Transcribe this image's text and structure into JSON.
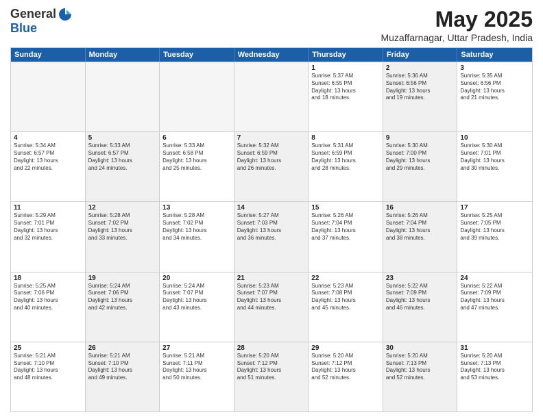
{
  "logo": {
    "general": "General",
    "blue": "Blue"
  },
  "header": {
    "month": "May 2025",
    "location": "Muzaffarnagar, Uttar Pradesh, India"
  },
  "days": [
    "Sunday",
    "Monday",
    "Tuesday",
    "Wednesday",
    "Thursday",
    "Friday",
    "Saturday"
  ],
  "rows": [
    [
      {
        "day": "",
        "text": "",
        "empty": true
      },
      {
        "day": "",
        "text": "",
        "empty": true
      },
      {
        "day": "",
        "text": "",
        "empty": true
      },
      {
        "day": "",
        "text": "",
        "empty": true
      },
      {
        "day": "1",
        "text": "Sunrise: 5:37 AM\nSunset: 6:55 PM\nDaylight: 13 hours\nand 18 minutes.",
        "shaded": false
      },
      {
        "day": "2",
        "text": "Sunrise: 5:36 AM\nSunset: 6:56 PM\nDaylight: 13 hours\nand 19 minutes.",
        "shaded": true
      },
      {
        "day": "3",
        "text": "Sunrise: 5:35 AM\nSunset: 6:56 PM\nDaylight: 13 hours\nand 21 minutes.",
        "shaded": false
      }
    ],
    [
      {
        "day": "4",
        "text": "Sunrise: 5:34 AM\nSunset: 6:57 PM\nDaylight: 13 hours\nand 22 minutes.",
        "shaded": false
      },
      {
        "day": "5",
        "text": "Sunrise: 5:33 AM\nSunset: 6:57 PM\nDaylight: 13 hours\nand 24 minutes.",
        "shaded": true
      },
      {
        "day": "6",
        "text": "Sunrise: 5:33 AM\nSunset: 6:58 PM\nDaylight: 13 hours\nand 25 minutes.",
        "shaded": false
      },
      {
        "day": "7",
        "text": "Sunrise: 5:32 AM\nSunset: 6:59 PM\nDaylight: 13 hours\nand 26 minutes.",
        "shaded": true
      },
      {
        "day": "8",
        "text": "Sunrise: 5:31 AM\nSunset: 6:59 PM\nDaylight: 13 hours\nand 28 minutes.",
        "shaded": false
      },
      {
        "day": "9",
        "text": "Sunrise: 5:30 AM\nSunset: 7:00 PM\nDaylight: 13 hours\nand 29 minutes.",
        "shaded": true
      },
      {
        "day": "10",
        "text": "Sunrise: 5:30 AM\nSunset: 7:01 PM\nDaylight: 13 hours\nand 30 minutes.",
        "shaded": false
      }
    ],
    [
      {
        "day": "11",
        "text": "Sunrise: 5:29 AM\nSunset: 7:01 PM\nDaylight: 13 hours\nand 32 minutes.",
        "shaded": false
      },
      {
        "day": "12",
        "text": "Sunrise: 5:28 AM\nSunset: 7:02 PM\nDaylight: 13 hours\nand 33 minutes.",
        "shaded": true
      },
      {
        "day": "13",
        "text": "Sunrise: 5:28 AM\nSunset: 7:02 PM\nDaylight: 13 hours\nand 34 minutes.",
        "shaded": false
      },
      {
        "day": "14",
        "text": "Sunrise: 5:27 AM\nSunset: 7:03 PM\nDaylight: 13 hours\nand 36 minutes.",
        "shaded": true
      },
      {
        "day": "15",
        "text": "Sunrise: 5:26 AM\nSunset: 7:04 PM\nDaylight: 13 hours\nand 37 minutes.",
        "shaded": false
      },
      {
        "day": "16",
        "text": "Sunrise: 5:26 AM\nSunset: 7:04 PM\nDaylight: 13 hours\nand 38 minutes.",
        "shaded": true
      },
      {
        "day": "17",
        "text": "Sunrise: 5:25 AM\nSunset: 7:05 PM\nDaylight: 13 hours\nand 39 minutes.",
        "shaded": false
      }
    ],
    [
      {
        "day": "18",
        "text": "Sunrise: 5:25 AM\nSunset: 7:06 PM\nDaylight: 13 hours\nand 40 minutes.",
        "shaded": false
      },
      {
        "day": "19",
        "text": "Sunrise: 5:24 AM\nSunset: 7:06 PM\nDaylight: 13 hours\nand 42 minutes.",
        "shaded": true
      },
      {
        "day": "20",
        "text": "Sunrise: 5:24 AM\nSunset: 7:07 PM\nDaylight: 13 hours\nand 43 minutes.",
        "shaded": false
      },
      {
        "day": "21",
        "text": "Sunrise: 5:23 AM\nSunset: 7:07 PM\nDaylight: 13 hours\nand 44 minutes.",
        "shaded": true
      },
      {
        "day": "22",
        "text": "Sunrise: 5:23 AM\nSunset: 7:08 PM\nDaylight: 13 hours\nand 45 minutes.",
        "shaded": false
      },
      {
        "day": "23",
        "text": "Sunrise: 5:22 AM\nSunset: 7:09 PM\nDaylight: 13 hours\nand 46 minutes.",
        "shaded": true
      },
      {
        "day": "24",
        "text": "Sunrise: 5:22 AM\nSunset: 7:09 PM\nDaylight: 13 hours\nand 47 minutes.",
        "shaded": false
      }
    ],
    [
      {
        "day": "25",
        "text": "Sunrise: 5:21 AM\nSunset: 7:10 PM\nDaylight: 13 hours\nand 48 minutes.",
        "shaded": false
      },
      {
        "day": "26",
        "text": "Sunrise: 5:21 AM\nSunset: 7:10 PM\nDaylight: 13 hours\nand 49 minutes.",
        "shaded": true
      },
      {
        "day": "27",
        "text": "Sunrise: 5:21 AM\nSunset: 7:11 PM\nDaylight: 13 hours\nand 50 minutes.",
        "shaded": false
      },
      {
        "day": "28",
        "text": "Sunrise: 5:20 AM\nSunset: 7:12 PM\nDaylight: 13 hours\nand 51 minutes.",
        "shaded": true
      },
      {
        "day": "29",
        "text": "Sunrise: 5:20 AM\nSunset: 7:12 PM\nDaylight: 13 hours\nand 52 minutes.",
        "shaded": false
      },
      {
        "day": "30",
        "text": "Sunrise: 5:20 AM\nSunset: 7:13 PM\nDaylight: 13 hours\nand 52 minutes.",
        "shaded": true
      },
      {
        "day": "31",
        "text": "Sunrise: 5:20 AM\nSunset: 7:13 PM\nDaylight: 13 hours\nand 53 minutes.",
        "shaded": false
      }
    ]
  ]
}
